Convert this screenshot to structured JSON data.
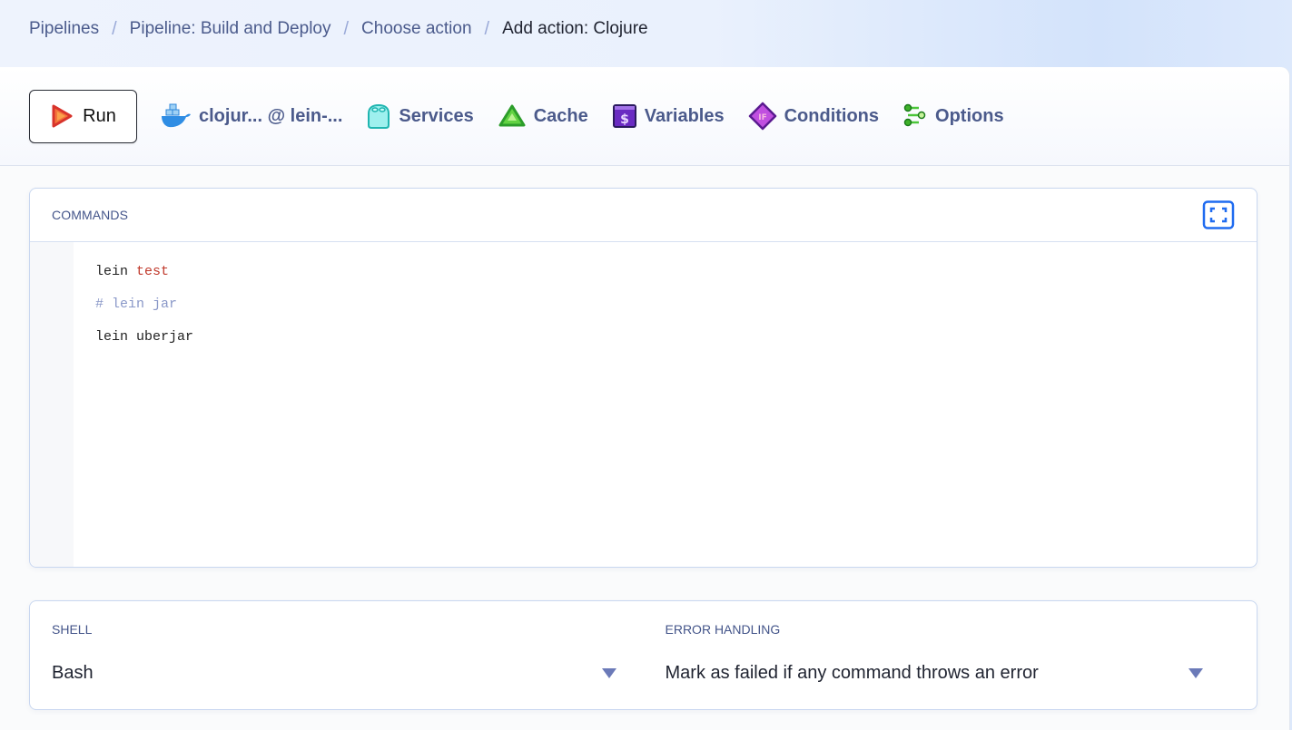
{
  "breadcrumb": [
    {
      "label": "Pipelines",
      "current": false
    },
    {
      "label": "Pipeline: Build and Deploy",
      "current": false
    },
    {
      "label": "Choose action",
      "current": false
    },
    {
      "label": "Add action: Clojure",
      "current": true
    }
  ],
  "breadcrumb_separator": "/",
  "toolbar": {
    "run_label": "Run",
    "tabs": [
      {
        "label": "clojur... @ lein-...",
        "icon": "docker-icon"
      },
      {
        "label": "Services",
        "icon": "services-icon"
      },
      {
        "label": "Cache",
        "icon": "cache-icon"
      },
      {
        "label": "Variables",
        "icon": "variables-icon"
      },
      {
        "label": "Conditions",
        "icon": "conditions-icon"
      },
      {
        "label": "Options",
        "icon": "options-icon"
      }
    ]
  },
  "commands": {
    "title": "COMMANDS",
    "lines": [
      {
        "parts": [
          {
            "text": "lein ",
            "style": "plain"
          },
          {
            "text": "test",
            "style": "keyword"
          }
        ]
      },
      {
        "parts": [
          {
            "text": "# lein jar",
            "style": "comment"
          }
        ]
      },
      {
        "parts": [
          {
            "text": "lein uberjar",
            "style": "plain"
          }
        ]
      }
    ]
  },
  "shell": {
    "label": "SHELL",
    "value": "Bash"
  },
  "error_handling": {
    "label": "ERROR HANDLING",
    "value": "Mark as failed if any command throws an error"
  },
  "colors": {
    "accent": "#1f6bf0",
    "tab_text": "#4b5a8b",
    "keyword": "#c0392b",
    "comment": "#8a98c8"
  }
}
